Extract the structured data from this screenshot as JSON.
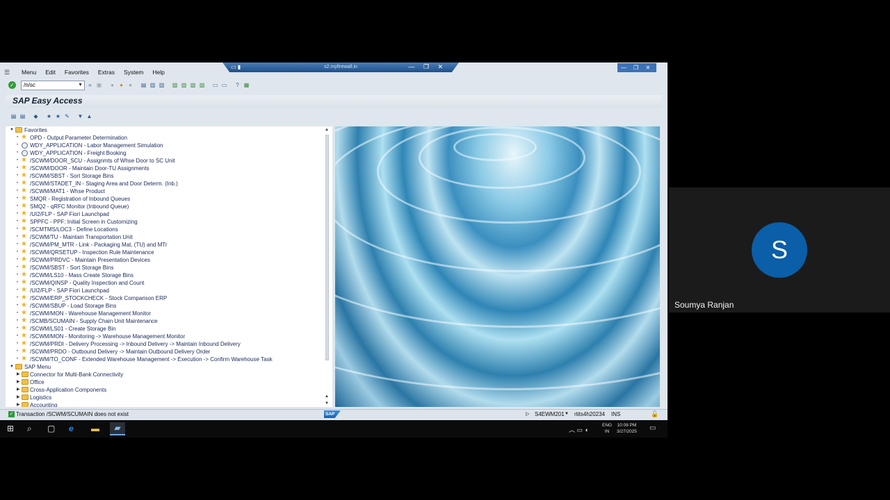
{
  "remote_session": {
    "title": "s2.myfirewall.in",
    "icons": "▭ ▮",
    "controls": "— ❐ ✕"
  },
  "window_controls": "— ❐ ✕",
  "menubar": [
    "Menu",
    "Edit",
    "Favorites",
    "Extras",
    "System",
    "Help"
  ],
  "toolbar": {
    "command_value": "/n/sc"
  },
  "page": {
    "title": "SAP Easy Access"
  },
  "tree": {
    "favorites_label": "Favorites",
    "favorites": [
      {
        "icon": "star",
        "label": "OPD - Output Parameter Determination"
      },
      {
        "icon": "web",
        "label": "WDY_APPLICATION - Labor Management Simulation"
      },
      {
        "icon": "web",
        "label": "WDY_APPLICATION - Freight Booking"
      },
      {
        "icon": "star",
        "label": "/SCWM/DOOR_SCU - Assignmts of Whse Door to SC Unit"
      },
      {
        "icon": "star",
        "label": "/SCWM/DOOR - Maintain Door-TU Assignments"
      },
      {
        "icon": "star",
        "label": "/SCWM/SBST - Sort Storage Bins"
      },
      {
        "icon": "star",
        "label": "/SCWM/STADET_IN - Staging Area and Door Determ. (Inb.)"
      },
      {
        "icon": "star",
        "label": "/SCWM/MAT1 - Whse Product"
      },
      {
        "icon": "star",
        "label": "SMQR - Registration of Inbound Queues"
      },
      {
        "icon": "star",
        "label": "SMQ2 - qRFC Monitor (Inbound Queue)"
      },
      {
        "icon": "star",
        "label": "/UI2/FLP - SAP Fiori Launchpad"
      },
      {
        "icon": "star",
        "label": "SPPFC - PPF: Initial Screen in Customizing"
      },
      {
        "icon": "star",
        "label": "/SCMTMS/LOC3 - Define Locations"
      },
      {
        "icon": "star",
        "label": "/SCWM/TU - Maintain Transportation Unit"
      },
      {
        "icon": "star",
        "label": "/SCWM/PM_MTR - Link - Packaging Mat. (TU) and MTr"
      },
      {
        "icon": "star",
        "label": "/SCWM/QRSETUP - Inspection Rule Maintenance"
      },
      {
        "icon": "star",
        "label": "/SCWM/PRDVC - Maintain Presentation Devices"
      },
      {
        "icon": "star",
        "label": "/SCWM/SBST - Sort Storage Bins"
      },
      {
        "icon": "star",
        "label": "/SCWM/LS10 - Mass Create Storage Bins"
      },
      {
        "icon": "star",
        "label": "/SCWM/QINSP - Quality Inspection and Count"
      },
      {
        "icon": "star",
        "label": "/UI2/FLP - SAP Fiori Launchpad"
      },
      {
        "icon": "star",
        "label": "/SCWM/ERP_STOCKCHECK - Stock Comparison ERP"
      },
      {
        "icon": "star",
        "label": "/SCWM/SBUP - Load Storage Bins"
      },
      {
        "icon": "star",
        "label": "/SCWM/MON - Warehouse Management Monitor"
      },
      {
        "icon": "star",
        "label": "/SCMB/SCUMAIN - Supply Chain Unit Maintenance"
      },
      {
        "icon": "star",
        "label": "/SCWM/LS01 - Create Storage Bin"
      },
      {
        "icon": "star",
        "label": "/SCWM/MON - Monitoring -> Warehouse Management Monitor"
      },
      {
        "icon": "star",
        "label": "/SCWM/PRDI - Delivery Processing -> Inbound Delivery -> Maintain Inbound Delivery"
      },
      {
        "icon": "star",
        "label": "/SCWM/PRDO - Outbound Delivery -> Maintain Outbound Delivery Order"
      },
      {
        "icon": "star",
        "label": "/SCWM/TO_CONF - Extended Warehouse Management -> Execution -> Confirm Warehouse Task"
      }
    ],
    "sapmenu_label": "SAP Menu",
    "sapmenu": [
      "Connector for Multi-Bank Connectivity",
      "Office",
      "Cross-Application Components",
      "Logistics",
      "Accounting"
    ]
  },
  "status": {
    "message": "Transaction /SCWM/SCUMAIN does not exist",
    "logo": "SAP",
    "system": "S4EWM201",
    "host": "rtits4h20234",
    "mode": "INS"
  },
  "taskbar": {
    "lang_top": "ENG",
    "lang_bottom": "IN",
    "time": "10:08 PM",
    "date": "3/27/2025"
  },
  "participant": {
    "initial": "S",
    "name": "Soumya Ranjan"
  }
}
